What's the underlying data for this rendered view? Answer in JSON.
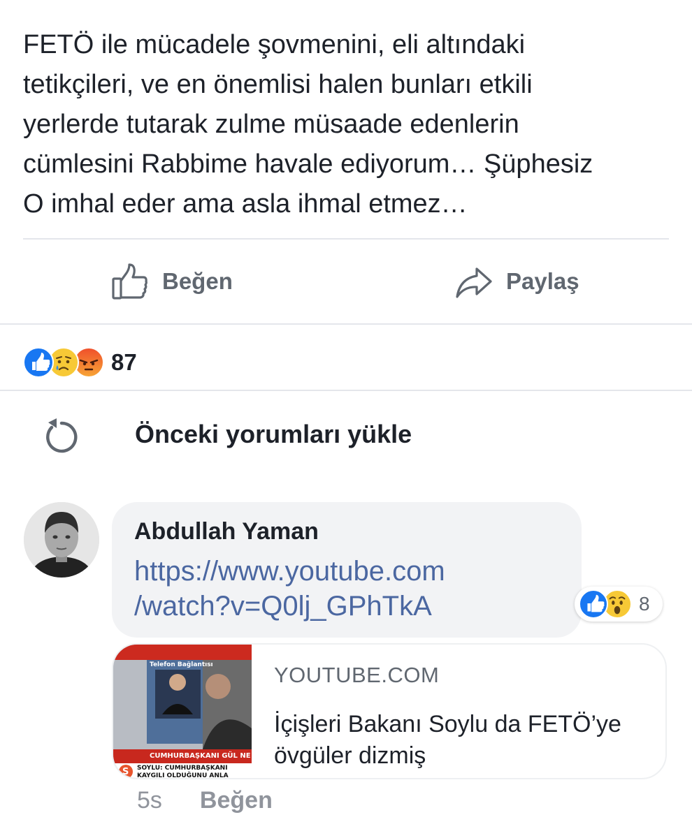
{
  "post": {
    "text": "FETÖ ile mücadele şovmenini, eli altındaki\ntetikçileri, ve en önemlisi halen bunları etkili\nyerlerde tutarak zulme müsaade edenlerin\ncümlesini Rabbime havale ediyorum… Şüphesiz\nO imhal eder ama asla ihmal etmez…"
  },
  "actions": {
    "like_label": "Beğen",
    "share_label": "Paylaş"
  },
  "reactions": {
    "icons": [
      "like-icon",
      "sad-icon",
      "angry-icon"
    ],
    "count": "87"
  },
  "comments": {
    "load_previous_label": "Önceki yorumları yükle",
    "items": [
      {
        "author": "Abdullah Yaman",
        "link": "https://www.youtube.com/watch?v=Q0lj_GPhTkA",
        "link_display": "https://www.youtube.com\n/watch?v=Q0lj_GPhTkA",
        "reactions": {
          "icons": [
            "like-icon",
            "wow-icon"
          ],
          "count": "8"
        },
        "preview": {
          "domain": "YOUTUBE.COM",
          "title": "İçişleri Bakanı Soylu da FETÖ’ye övgüler dizmiş",
          "thumb_texts": {
            "tag": "Telefon Bağlantısı",
            "banner": "CUMHURBAŞKANI GÜL NE",
            "ticker": "SOYLU: CUMHURBAŞKANI",
            "ticker2": "KAYGILI OLDUĞUNU ANLA",
            "logo": "S"
          }
        },
        "time": "5s",
        "like_label": "Beğen"
      }
    ]
  },
  "colors": {
    "link": "#4b67a1",
    "like_blue": "#1877f2",
    "angry_red": "#f0502b",
    "muted": "#90949c"
  }
}
